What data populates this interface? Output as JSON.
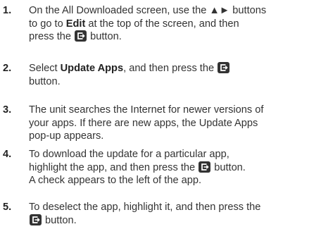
{
  "steps": [
    {
      "number": "1.",
      "line1_a": "On the All Downloaded screen, use the ▲► buttons",
      "line2_a": "to go to ",
      "line2_bold": "Edit",
      "line2_b": " at the top of the screen, and then",
      "line3_a": "press the ",
      "line3_b": " button."
    },
    {
      "number": "2.",
      "line1_a": "Select ",
      "line1_bold": "Update Apps",
      "line1_b": ", and then press the ",
      "line2_a": "button."
    },
    {
      "number": "3.",
      "line1_a": "The unit searches the Internet for newer versions of",
      "line2_a": "your apps. If there are new apps, the Update Apps",
      "line3_a": "pop-up appears."
    },
    {
      "number": "4.",
      "line1_a": "To download the update for a particular app,",
      "line2_a": "highlight the app, and then press the ",
      "line2_b": " button.",
      "line3_a": "A check appears to the left of the app."
    },
    {
      "number": "5.",
      "line1_a": "To deselect the app, highlight it, and then press the",
      "line2_b": " button."
    }
  ],
  "icons": {
    "enter": "enter-button-icon"
  },
  "colors": {
    "text": "#333333",
    "icon_bg": "#333333"
  }
}
